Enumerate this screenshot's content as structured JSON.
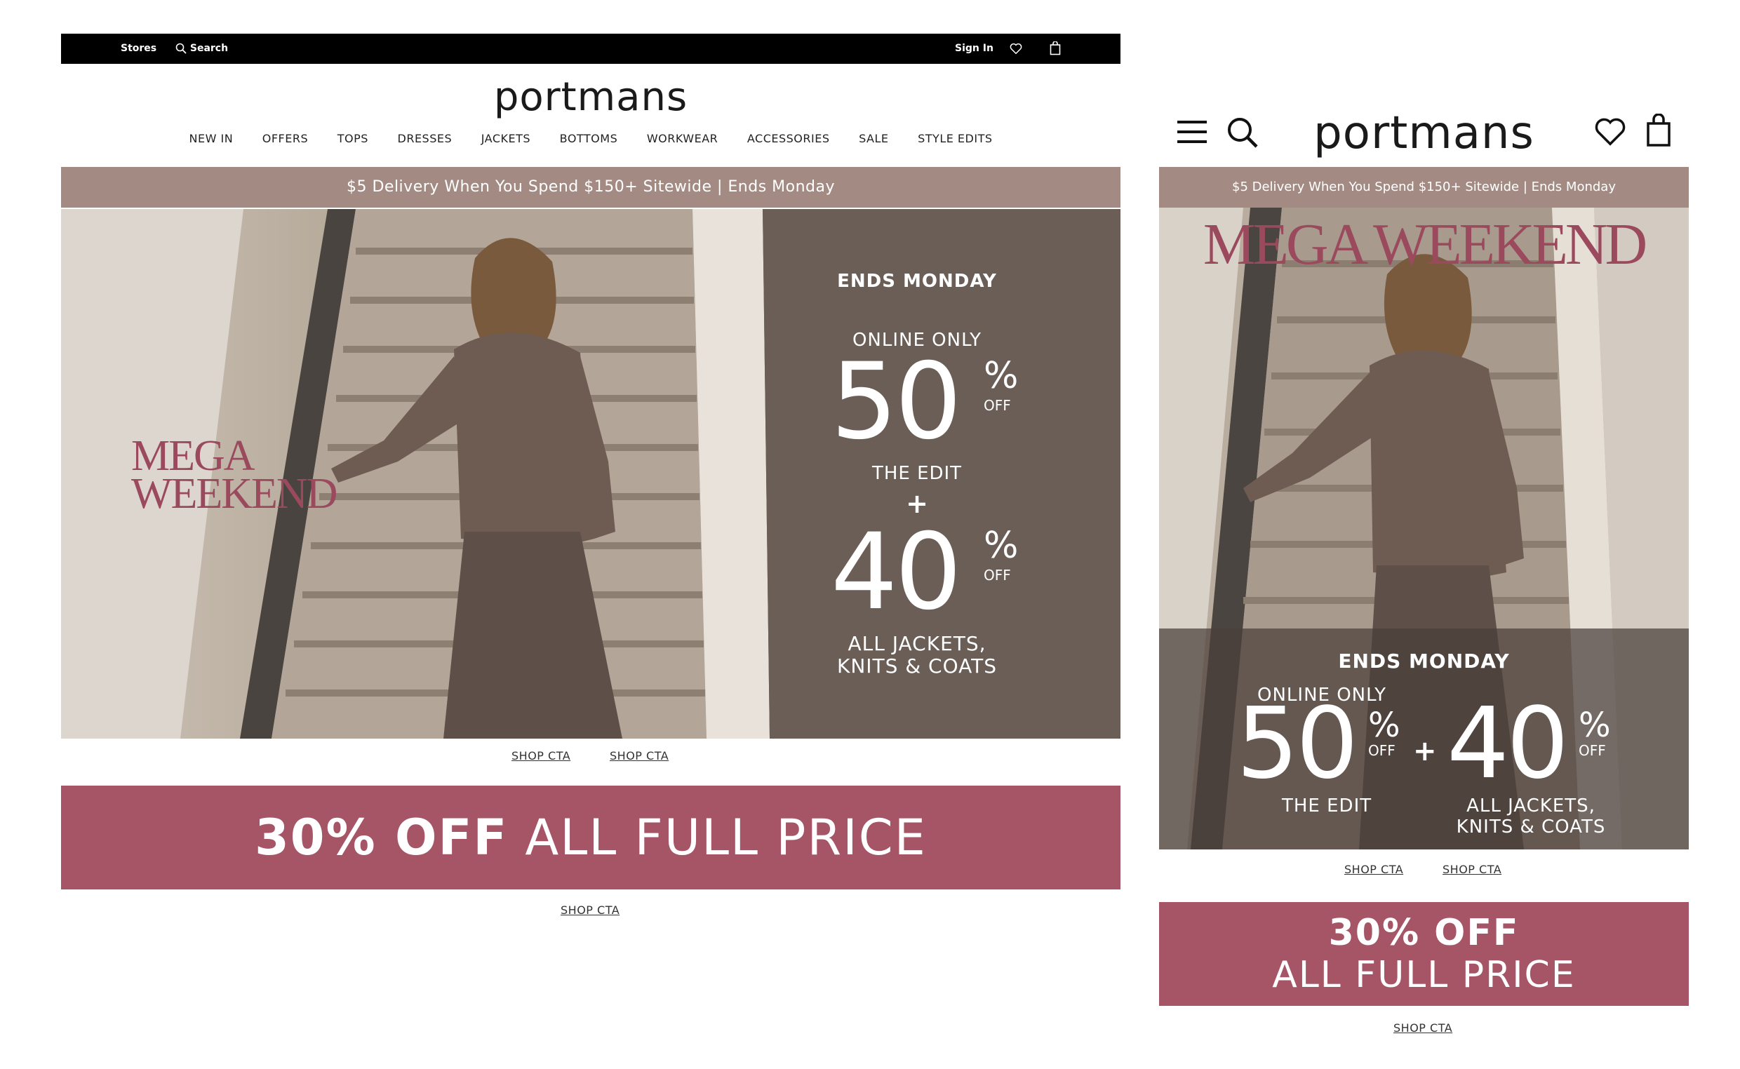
{
  "desktop": {
    "topbar": {
      "stores": "Stores",
      "search": "Search",
      "sign_in": "Sign In"
    },
    "logo": "portmans",
    "nav": [
      "NEW IN",
      "OFFERS",
      "TOPS",
      "DRESSES",
      "JACKETS",
      "BOTTOMS",
      "WORKWEAR",
      "ACCESSORIES",
      "SALE",
      "STYLE EDITS"
    ],
    "promo": "$5 Delivery When You Spend $150+ Sitewide | Ends Monday",
    "hero": {
      "mega1": "MEGA",
      "mega2": "WEEKEND",
      "ends": "ENDS MONDAY",
      "online_only": "ONLINE ONLY",
      "offer1_num": "50",
      "pct": "%",
      "off": "OFF",
      "offer1_label": "THE EDIT",
      "plus": "+",
      "offer2_num": "40",
      "offer2_line1": "ALL JACKETS,",
      "offer2_line2": "KNITS & COATS"
    },
    "cta1": "SHOP CTA",
    "cta2": "SHOP CTA",
    "banner_bold": "30% OFF",
    "banner_rest": "ALL FULL PRICE",
    "cta3": "SHOP CTA"
  },
  "mobile": {
    "logo": "portmans",
    "promo": "$5 Delivery When You Spend $150+ Sitewide | Ends Monday",
    "hero": {
      "mega": "MEGA WEEKEND",
      "ends": "ENDS MONDAY",
      "online_only": "ONLINE ONLY",
      "offer1_num": "50",
      "pct": "%",
      "off": "OFF",
      "offer1_label": "THE EDIT",
      "plus": "+",
      "offer2_num": "40",
      "offer2_line1": "ALL JACKETS,",
      "offer2_line2": "KNITS & COATS"
    },
    "cta1": "SHOP CTA",
    "cta2": "SHOP CTA",
    "banner_line1": "30% OFF",
    "banner_line2": "ALL FULL PRICE",
    "cta3": "SHOP CTA"
  },
  "colors": {
    "promo_bar": "#a38b84",
    "banner": "#a55565",
    "mega_text": "#9b4a5e",
    "topbar": "#000000"
  },
  "icons": [
    "search-icon",
    "heart-icon",
    "bag-icon",
    "menu-icon"
  ]
}
